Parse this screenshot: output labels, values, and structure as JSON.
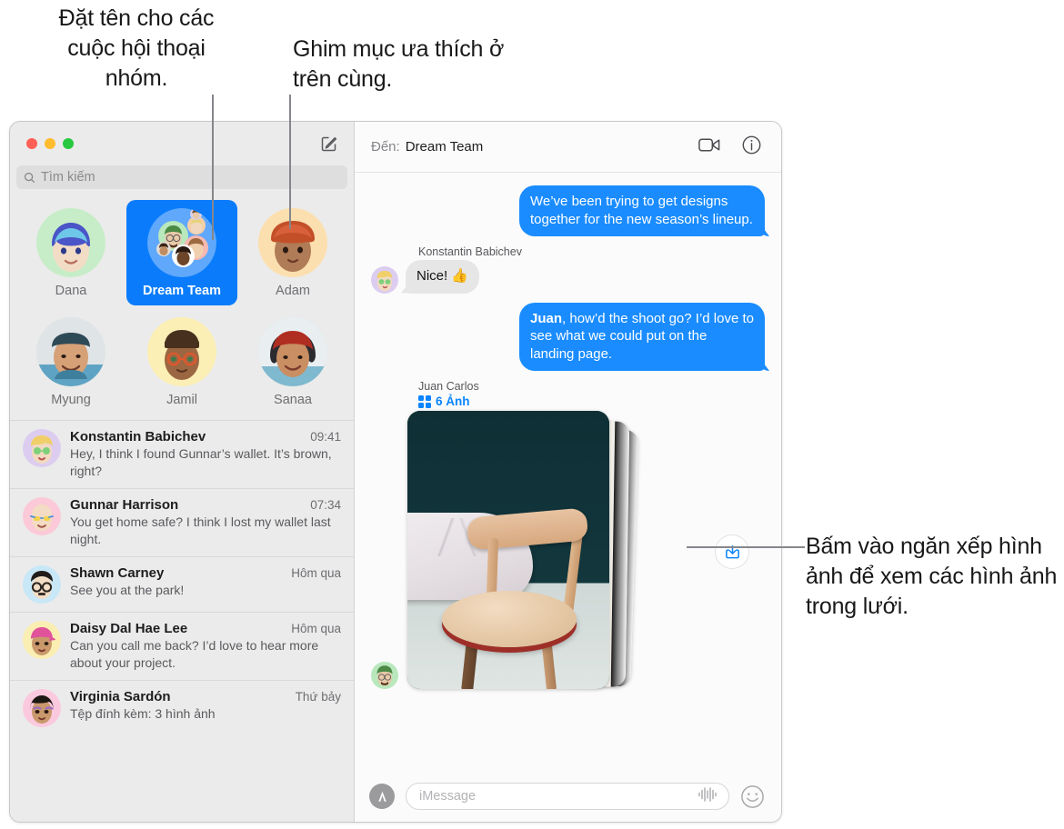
{
  "callouts": {
    "left": "Đặt tên cho các cuộc hội thoại nhóm.",
    "middle": "Ghim mục ưa thích ở trên cùng.",
    "right": "Bấm vào ngăn xếp hình ảnh để xem các hình ảnh trong lưới."
  },
  "window": {
    "traffic_lights": [
      "close",
      "minimize",
      "zoom"
    ],
    "compose_icon": "compose-icon"
  },
  "sidebar": {
    "search": {
      "placeholder": "Tìm kiếm",
      "icon": "search-icon"
    },
    "pinned": [
      {
        "name": "Dana",
        "icon": "memoji-dana",
        "bg": "#c7edc8",
        "glyph": "👩🏻‍🦱",
        "selected": false
      },
      {
        "name": "Dream Team",
        "icon": "group-avatar",
        "bg": "#0a7cfb",
        "glyph": "",
        "selected": true
      },
      {
        "name": "Adam",
        "icon": "memoji-adam",
        "bg": "#fcdfae",
        "glyph": "🧑🏽",
        "selected": false
      },
      {
        "name": "Myung",
        "icon": "photo-myung",
        "bg": "#e8e6e2",
        "glyph": "🧑🏻",
        "selected": false
      },
      {
        "name": "Jamil",
        "icon": "memoji-jamil",
        "bg": "#fcefb6",
        "glyph": "👨🏾",
        "selected": false
      },
      {
        "name": "Sanaa",
        "icon": "photo-sanaa",
        "bg": "#cfd9dd",
        "glyph": "👩🏽",
        "selected": false
      }
    ],
    "conversations": [
      {
        "name": "Konstantin Babichev",
        "time": "09:41",
        "preview": "Hey, I think I found Gunnar’s wallet. It’s brown, right?",
        "avatar_bg": "#dccdf0",
        "glyph": "🧑🏼"
      },
      {
        "name": "Gunnar Harrison",
        "time": "07:34",
        "preview": "You get home safe? I think I lost my wallet last night.",
        "avatar_bg": "#fbc9d7",
        "glyph": "👨🏼‍🦲"
      },
      {
        "name": "Shawn Carney",
        "time": "Hôm qua",
        "preview": "See you at the park!",
        "avatar_bg": "#c8e7f7",
        "glyph": "👨🏻"
      },
      {
        "name": "Daisy Dal Hae Lee",
        "time": "Hôm qua",
        "preview": "Can you call me back? I’d love to hear more about your project.",
        "avatar_bg": "#fbeeb3",
        "glyph": "👩🏽"
      },
      {
        "name": "Virginia Sardón",
        "time": "Thứ bảy",
        "preview": "Tệp đính kèm:  3 hình ảnh",
        "avatar_bg": "#fbc9dd",
        "glyph": "👩🏽"
      }
    ]
  },
  "chat": {
    "header": {
      "to_label": "Đến:",
      "to_value": "Dream Team",
      "facetime_icon": "video-camera-icon",
      "info_icon": "info-circle-icon"
    },
    "messages": [
      {
        "type": "outgoing",
        "text": "We’ve been trying to get designs together for the new season’s lineup."
      },
      {
        "type": "incoming",
        "sender": "Konstantin Babichev",
        "text": "Nice!  👍",
        "avatar_bg": "#dccdf0",
        "glyph": "🧑🏼"
      },
      {
        "type": "outgoing",
        "bold_prefix": "Juan",
        "text": ", how’d the shoot go? I’d love to see what we could put on the landing page."
      },
      {
        "type": "attachment",
        "sender": "Juan Carlos",
        "count_label": "6 Ảnh",
        "grid_icon": "grid-icon",
        "avatar_bg": "#b9e8bd",
        "glyph": "🧔🏻",
        "save_icon": "save-download-icon"
      }
    ],
    "composer": {
      "apps_icon": "app-store-icon",
      "placeholder": "iMessage",
      "audio_icon": "audio-waveform-icon",
      "emoji_icon": "emoji-smiley-icon"
    }
  },
  "colors": {
    "accent_blue": "#0a7cfb",
    "bubble_out": "#1a8cff",
    "bubble_in": "#e6e6e6",
    "link_blue": "#0a84ff"
  }
}
